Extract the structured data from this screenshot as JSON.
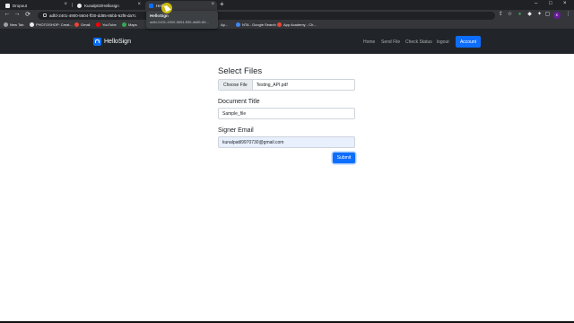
{
  "browser": {
    "tabs": [
      {
        "label": "Dropout",
        "favicon_color": "#e8eaed"
      },
      {
        "label": "Kunalp02/Hellosign",
        "favicon_color": "#e8eaed"
      },
      {
        "label": "Hello",
        "favicon_color": "#0d6efd"
      }
    ],
    "new_tab_glyph": "+",
    "window_controls": [
      "–",
      "□",
      "×"
    ],
    "tooltip": {
      "title": "HelloSign",
      "url": "adfd-2401-4900-5604-ff30-dd85-85..."
    },
    "address": "adfd-2401-4900-5604-ff30-dd85-85bb-62f8-da7c",
    "profile_initial": "K",
    "bookmarks": [
      {
        "label": "New Tab",
        "color": "#9aa0a6"
      },
      {
        "label": "PHOTOSHOP: Creat...",
        "color": "#e8eaed"
      },
      {
        "label": "Gmail",
        "color": "#ea4335"
      },
      {
        "label": "YouTube",
        "color": "#ff0000"
      },
      {
        "label": "Maps",
        "color": "#34a853"
      },
      {
        "label": "Ap...",
        "color": "#9aa0a6"
      },
      {
        "label": "NTA - Google Search",
        "color": "#4285f4"
      },
      {
        "label": "App Academy - Ch...",
        "color": "#ea4335"
      }
    ]
  },
  "app": {
    "brand": "HelloSign",
    "nav": [
      "Home",
      "Send File",
      "Check Status",
      "logout"
    ],
    "account_label": "Account"
  },
  "form": {
    "heading": "Select Files",
    "choose_label": "Choose File",
    "file_name": "Testing_API.pdf",
    "title_label": "Document Title",
    "title_value": "Sample_file",
    "email_label": "Signer Email",
    "email_value": "kunalpatil9970730@gmail.com",
    "submit_label": "Submit"
  },
  "colors": {
    "accent": "#0d6efd",
    "navbar": "#212529"
  }
}
